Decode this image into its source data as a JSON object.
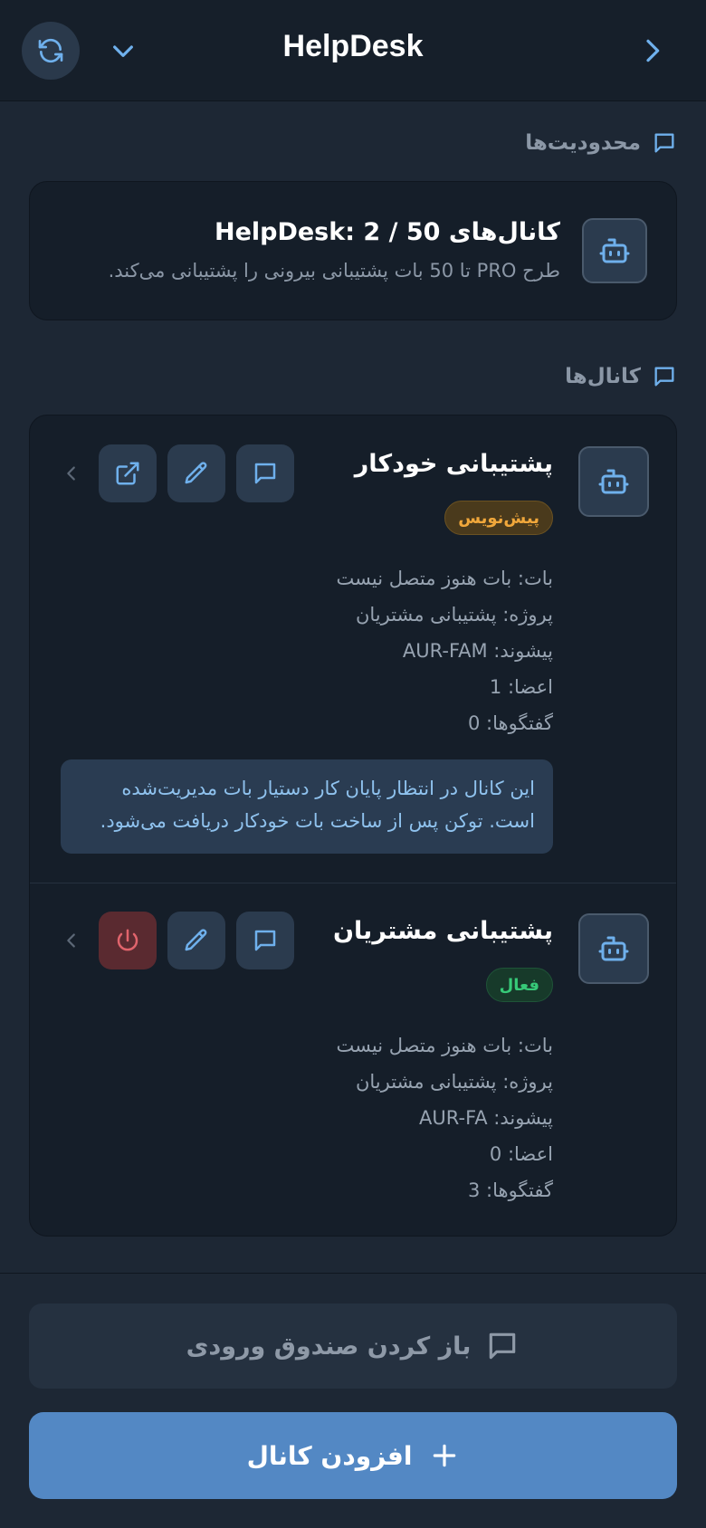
{
  "header": {
    "title": "HelpDesk"
  },
  "limits_section": {
    "heading": "محدودیت‌ها",
    "title": "کانال‌های HelpDesk: 2 / 50",
    "description": "طرح PRO تا 50 بات پشتیبانی بیرونی را پشتیبانی می‌کند."
  },
  "channels_section": {
    "heading": "کانال‌ها",
    "items": [
      {
        "name": "پشتیبانی خودکار",
        "badge": "پیش‌نویس",
        "status": "draft",
        "bot_line": "بات: بات هنوز متصل نیست",
        "project_line": "پروژه: پشتیبانی مشتریان",
        "prefix_line": "پیشوند: AUR-FAM",
        "members_line": "اعضا: 1",
        "conversations_line": "گفتگوها: 0",
        "note_line1": "این کانال در انتظار پایان کار دستیار بات مدیریت‌شده",
        "note_line2": "است. توکن پس از ساخت بات خودکار دریافت می‌شود."
      },
      {
        "name": "پشتیبانی مشتریان",
        "badge": "فعال",
        "status": "active",
        "bot_line": "بات: بات هنوز متصل نیست",
        "project_line": "پروژه: پشتیبانی مشتریان",
        "prefix_line": "پیشوند: AUR-FA",
        "members_line": "اعضا: 0",
        "conversations_line": "گفتگوها: 3"
      }
    ]
  },
  "footer": {
    "inbox_label": "باز کردن صندوق ورودی",
    "add_label": "افزودن کانال"
  },
  "colors": {
    "background": "#1d2734",
    "card": "#151e29",
    "accent": "#5388c4",
    "icon_blue": "#6fb0ec",
    "draft": "#f0a73b",
    "active": "#37c978",
    "danger": "#e0646c"
  },
  "icons": {
    "refresh": "refresh-icon",
    "dropdown": "chevron-down-icon",
    "back": "chevron-right-icon",
    "section": "message-square-icon",
    "bot": "robot-icon",
    "chat": "message-square-icon",
    "edit": "pencil-icon",
    "external": "external-link-icon",
    "power": "power-icon",
    "row_expand": "chevron-left-icon",
    "add": "plus-icon"
  }
}
